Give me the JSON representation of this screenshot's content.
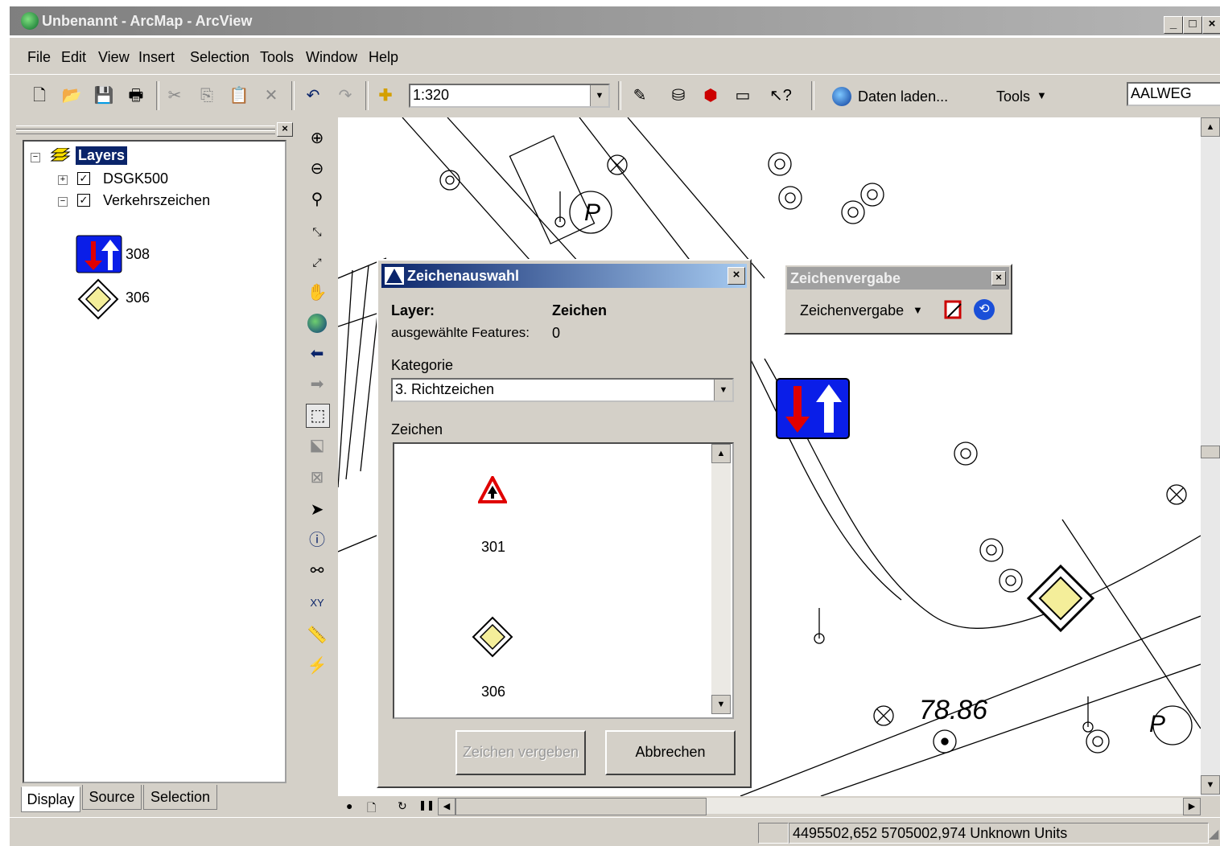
{
  "window": {
    "title": "Unbenannt - ArcMap - ArcView",
    "minimize": "_",
    "maximize": "□",
    "close": "×"
  },
  "menu": [
    "File",
    "Edit",
    "View",
    "Insert",
    "Selection",
    "Tools",
    "Window",
    "Help"
  ],
  "toolbar": {
    "scale_value": "1:320",
    "daten_laden": "Daten laden...",
    "tools_label": "Tools",
    "search_value": "AALWEG"
  },
  "toc": {
    "root_label": "Layers",
    "layers": [
      {
        "name": "DSGK500",
        "checked": true,
        "expanded": false
      },
      {
        "name": "Verkehrszeichen",
        "checked": true,
        "expanded": true
      }
    ],
    "legend": [
      {
        "label": "308",
        "icon": "priority-oncoming-sign-icon"
      },
      {
        "label": "306",
        "icon": "priority-road-sign-icon"
      }
    ],
    "tabs": [
      "Display",
      "Source",
      "Selection"
    ]
  },
  "dialog": {
    "title": "Zeichenauswahl",
    "layer_label": "Layer:",
    "layer_value": "Zeichen",
    "features_label": "ausgewählte Features:",
    "features_value": "0",
    "kategorie_label": "Kategorie",
    "kategorie_value": "3. Richtzeichen",
    "zeichen_label": "Zeichen",
    "signs": [
      {
        "label": "301",
        "icon": "priority-crossing-sign-icon"
      },
      {
        "label": "306",
        "icon": "priority-road-sign-icon"
      }
    ],
    "assign_button": "Zeichen vergeben",
    "cancel_button": "Abbrechen"
  },
  "zeichenvergabe": {
    "title": "Zeichenvergabe",
    "dropdown_label": "Zeichenvergabe"
  },
  "map": {
    "height_label": "78.86",
    "parking_label": "P"
  },
  "status": {
    "coordinates": "4495502,652  5705002,974 Unknown Units"
  },
  "colors": {
    "dialog_title_start": "#0a246a",
    "dialog_title_end": "#a6caf0",
    "sign_blue": "#0a1ee8",
    "sign_red": "#e00000",
    "sign_yellow": "#f4ee9a"
  }
}
